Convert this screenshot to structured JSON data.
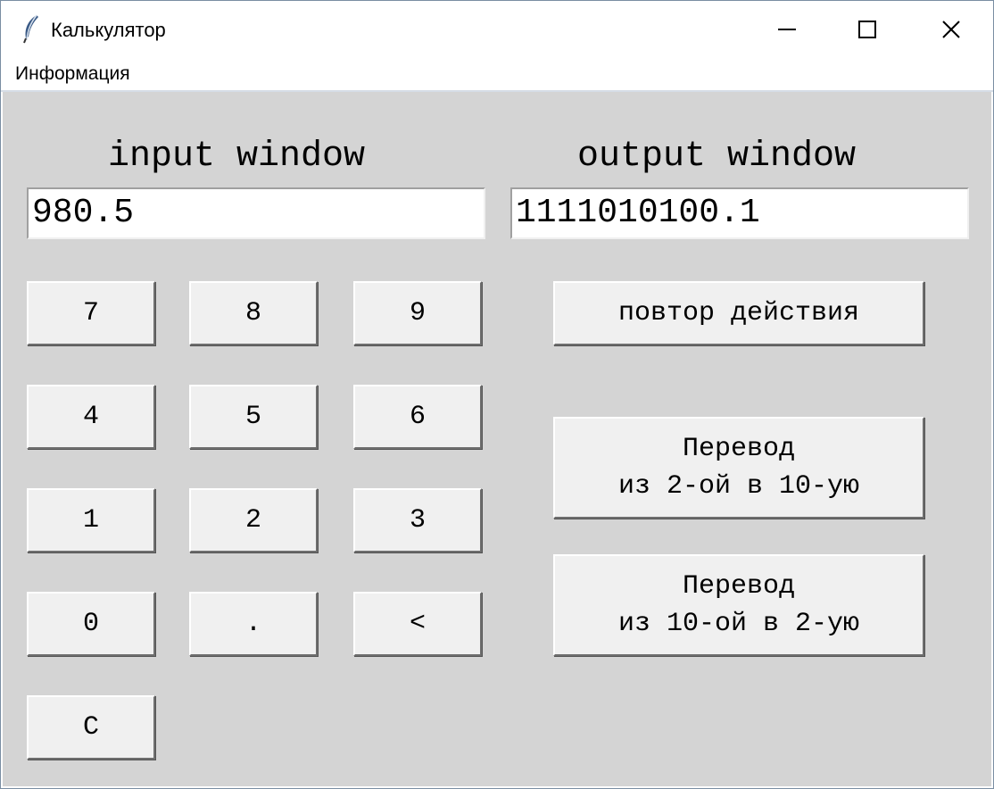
{
  "window": {
    "title": "Калькулятор"
  },
  "menu": {
    "items": [
      "Информация"
    ]
  },
  "labels": {
    "input_heading": "input window",
    "output_heading": "output window"
  },
  "fields": {
    "input_value": "980.5",
    "output_value": "1111010100.1"
  },
  "keypad": {
    "k7": "7",
    "k8": "8",
    "k9": "9",
    "k4": "4",
    "k5": "5",
    "k6": "6",
    "k1": "1",
    "k2": "2",
    "k3": "3",
    "k0": "0",
    "kdot": ".",
    "kback": "<",
    "kclear": "C"
  },
  "actions": {
    "repeat": "повтор действия",
    "bin_to_dec": "Перевод\nиз 2-ой в 10-ую",
    "dec_to_bin": "Перевод\nиз 10-ой в 2-ую"
  },
  "icons": {
    "app": "feather-icon",
    "minimize": "minimize-icon",
    "maximize": "maximize-icon",
    "close": "close-icon"
  },
  "colors": {
    "client_background": "#d4d4d4",
    "button_face": "#f0f0f0",
    "entry_background": "#ffffff"
  }
}
